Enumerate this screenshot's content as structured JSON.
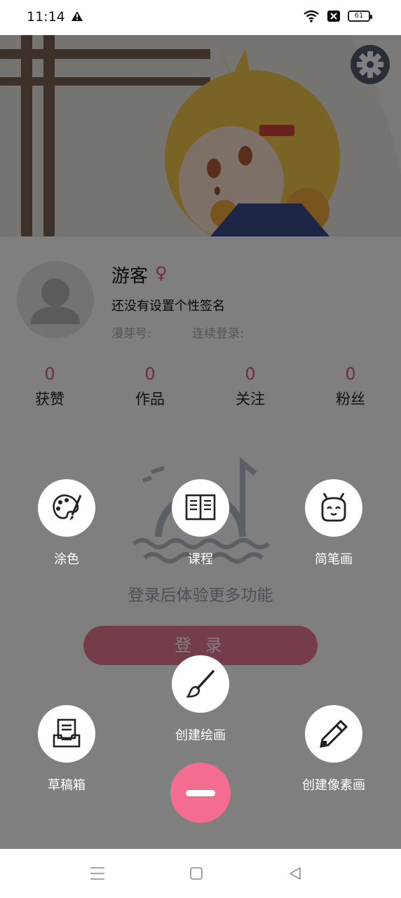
{
  "status_bar": {
    "time": "11:14",
    "battery": "61",
    "icons": [
      "warning-icon",
      "wifi-icon",
      "sim-off-icon",
      "battery-icon"
    ]
  },
  "profile": {
    "username": "游客",
    "gender_symbol": "♀",
    "signature": "还没有设置个性签名",
    "id_label": "漫芽号:",
    "login_streak_label": "连续登录:"
  },
  "stats": [
    {
      "value": "0",
      "label": "获赞"
    },
    {
      "value": "0",
      "label": "作品"
    },
    {
      "value": "0",
      "label": "关注"
    },
    {
      "value": "0",
      "label": "粉丝"
    }
  ],
  "empty_state": {
    "hint": "登录后体验更多功能",
    "login_button": "登 录"
  },
  "fab_menu": {
    "coloring": "涂色",
    "course": "课程",
    "simple_drawing": "简笔画",
    "create_drawing": "创建绘画",
    "drafts": "草稿箱",
    "create_pixel": "创建像素画"
  },
  "colors": {
    "accent": "#f46d90",
    "stat_number": "#e05a7a",
    "overlay": "rgba(0,0,0,0.5)"
  }
}
